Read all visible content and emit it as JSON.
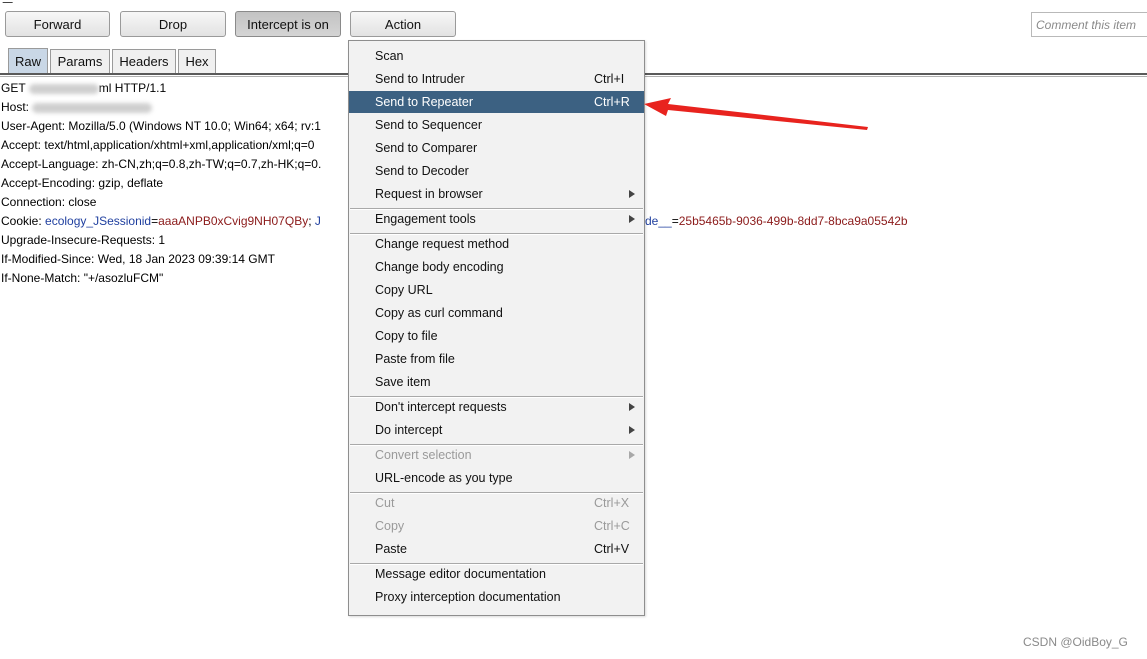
{
  "toolbar": {
    "forward_label": "Forward",
    "drop_label": "Drop",
    "intercept_label": "Intercept is on",
    "action_label": "Action",
    "comment_placeholder": "Comment this item"
  },
  "tabs": [
    "Raw",
    "Params",
    "Headers",
    "Hex"
  ],
  "active_tab": "Raw",
  "request": {
    "line1_prefix": "GET ",
    "line1_suffix": "ml HTTP/1.1",
    "host_label": "Host: ",
    "user_agent": "User-Agent: Mozilla/5.0 (Windows NT 10.0; Win64; x64; rv:1",
    "accept": "Accept: text/html,application/xhtml+xml,application/xml;q=0",
    "accept_language": "Accept-Language: zh-CN,zh;q=0.8,zh-TW;q=0.7,zh-HK;q=0.",
    "accept_encoding": "Accept-Encoding: gzip, deflate",
    "connection": "Connection: close",
    "cookie_label": "Cookie: ",
    "cookie_name1": "ecology_JSessionid",
    "cookie_eq1": "=",
    "cookie_val1": "aaaANPB0xCvig9NH07QBy",
    "cookie_sep": "; ",
    "cookie_name2_start": "J",
    "cookie_name2_end": "de__",
    "cookie_eq2": "=",
    "cookie_val2": "25b5465b-9036-499b-8dd7-8bca9a05542b",
    "upgrade": "Upgrade-Insecure-Requests: 1",
    "if_modified": "If-Modified-Since: Wed, 18 Jan 2023 09:39:14 GMT",
    "if_none_match": "If-None-Match: \"+/asozluFCM\""
  },
  "menu": {
    "items": [
      {
        "label": "Scan",
        "shortcut": ""
      },
      {
        "label": "Send to Intruder",
        "shortcut": "Ctrl+I"
      },
      {
        "label": "Send to Repeater",
        "shortcut": "Ctrl+R"
      },
      {
        "label": "Send to Sequencer",
        "shortcut": ""
      },
      {
        "label": "Send to Comparer",
        "shortcut": ""
      },
      {
        "label": "Send to Decoder",
        "shortcut": ""
      },
      {
        "label": "Request in browser",
        "shortcut": ""
      },
      {
        "label": "Engagement tools",
        "shortcut": ""
      },
      {
        "label": "Change request method",
        "shortcut": ""
      },
      {
        "label": "Change body encoding",
        "shortcut": ""
      },
      {
        "label": "Copy URL",
        "shortcut": ""
      },
      {
        "label": "Copy as curl command",
        "shortcut": ""
      },
      {
        "label": "Copy to file",
        "shortcut": ""
      },
      {
        "label": "Paste from file",
        "shortcut": ""
      },
      {
        "label": "Save item",
        "shortcut": ""
      },
      {
        "label": "Don't intercept requests",
        "shortcut": ""
      },
      {
        "label": "Do intercept",
        "shortcut": ""
      },
      {
        "label": "Convert selection",
        "shortcut": ""
      },
      {
        "label": "URL-encode as you type",
        "shortcut": ""
      },
      {
        "label": "Cut",
        "shortcut": "Ctrl+X"
      },
      {
        "label": "Copy",
        "shortcut": "Ctrl+C"
      },
      {
        "label": "Paste",
        "shortcut": "Ctrl+V"
      },
      {
        "label": "Message editor documentation",
        "shortcut": ""
      },
      {
        "label": "Proxy interception documentation",
        "shortcut": ""
      }
    ],
    "highlighted": "Send to Repeater",
    "disabled": [
      "Convert selection",
      "Cut",
      "Copy"
    ],
    "submenus": [
      "Request in browser",
      "Engagement tools",
      "Don't intercept requests",
      "Do intercept",
      "Convert selection"
    ]
  },
  "colors": {
    "highlight": "#3c6182",
    "arrow": "#e8231e",
    "cookie_name": "#1f3f9f",
    "cookie_value": "#8b1a1a"
  },
  "watermark": "CSDN @OidBoy_G"
}
